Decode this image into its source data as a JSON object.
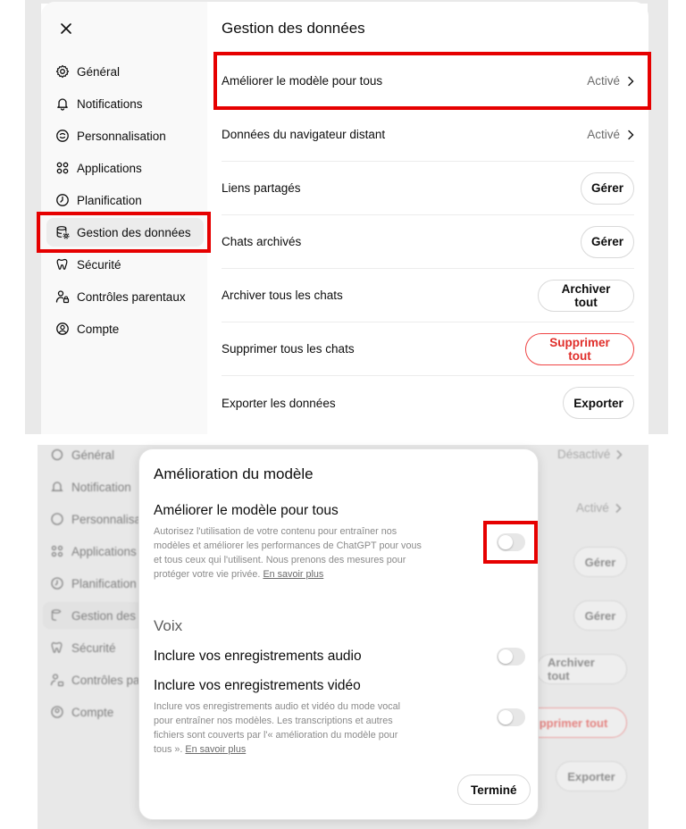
{
  "settings": {
    "close_label": "×",
    "title": "Gestion des données",
    "nav": [
      {
        "label": "Général",
        "icon": "gear-icon"
      },
      {
        "label": "Notifications",
        "icon": "bell-icon"
      },
      {
        "label": "Personnalisation",
        "icon": "personalization-icon"
      },
      {
        "label": "Applications",
        "icon": "apps-grid-icon"
      },
      {
        "label": "Planification",
        "icon": "clock-icon"
      },
      {
        "label": "Gestion des données",
        "icon": "database-gear-icon"
      },
      {
        "label": "Sécurité",
        "icon": "security-icon"
      },
      {
        "label": "Contrôles parentaux",
        "icon": "parental-icon"
      },
      {
        "label": "Compte",
        "icon": "account-icon"
      }
    ],
    "rows": [
      {
        "label": "Améliorer le modèle pour tous",
        "status": "Activé"
      },
      {
        "label": "Données du navigateur distant",
        "status": "Activé"
      },
      {
        "label": "Liens partagés",
        "button": "Gérer"
      },
      {
        "label": "Chats archivés",
        "button": "Gérer"
      },
      {
        "label": "Archiver tous les chats",
        "button": "Archiver tout"
      },
      {
        "label": "Supprimer tous les chats",
        "button": "Supprimer tout"
      },
      {
        "label": "Exporter les données",
        "button": "Exporter"
      }
    ]
  },
  "background": {
    "nav": [
      "Général",
      "Notification",
      "Personnalisa",
      "Applications",
      "Planification",
      "Gestion des",
      "Sécurité",
      "Contrôles pa",
      "Compte"
    ],
    "status_1": "Désactivé",
    "status_2": "Activé",
    "buttons": [
      "Gérer",
      "Gérer",
      "Archiver tout",
      "pprimer tout",
      "Exporter"
    ]
  },
  "dialog": {
    "title": "Amélioration du modèle",
    "improve_title": "Améliorer le modèle pour tous",
    "improve_desc": "Autorisez l'utilisation de votre contenu pour entraîner nos modèles et améliorer les performances de ChatGPT pour vous et tous ceux qui l'utilisent. Nous prenons des mesures pour protéger votre vie privée.",
    "learn_more": "En savoir plus",
    "improve_on": false,
    "voice_heading": "Voix",
    "audio_label": "Inclure vos enregistrements audio",
    "audio_on": false,
    "video_label": "Inclure vos enregistrements vidéo",
    "video_desc": "Inclure vos enregistrements audio et vidéo du mode vocal pour entraîner nos modèles. Les transcriptions et autres fichiers sont couverts par l'« amélioration du modèle pour tous ».",
    "video_learn_more": "En savoir plus",
    "video_on": false,
    "done_label": "Terminé"
  },
  "colors": {
    "highlight": "#e60000",
    "danger": "#e02e2a"
  }
}
